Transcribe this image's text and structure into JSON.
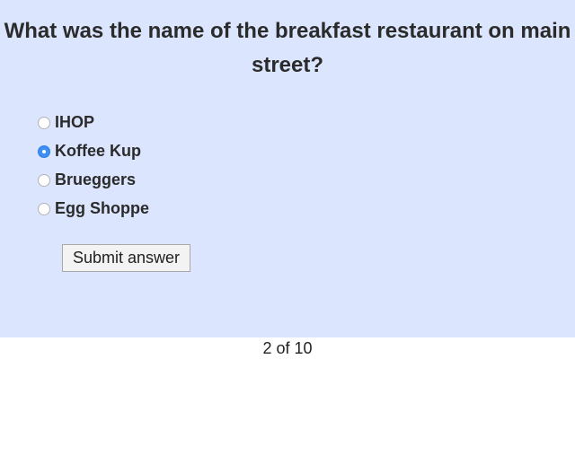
{
  "question": {
    "text": "What was the name of the breakfast restaurant on main street?"
  },
  "options": [
    {
      "label": "IHOP",
      "selected": false
    },
    {
      "label": "Koffee Kup",
      "selected": true
    },
    {
      "label": "Brueggers",
      "selected": false
    },
    {
      "label": "Egg Shoppe",
      "selected": false
    }
  ],
  "submit": {
    "label": "Submit answer"
  },
  "progress": {
    "text": "2 of 10"
  },
  "colors": {
    "panel_background": "#dbe6fe",
    "radio_selected": "#3d8ef5"
  }
}
